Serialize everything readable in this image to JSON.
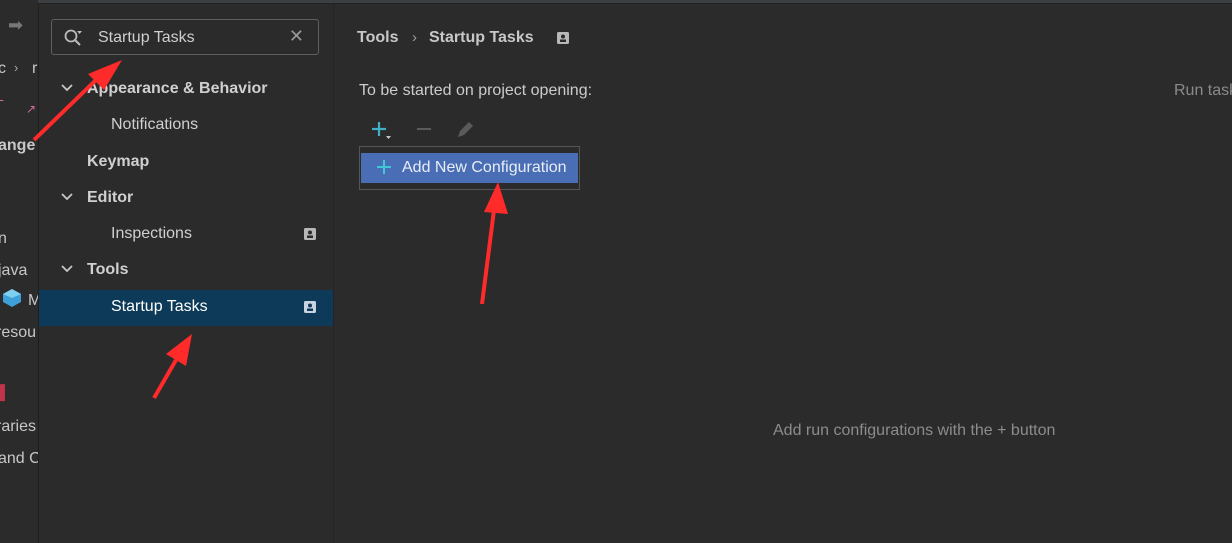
{
  "background_fragments": {
    "items": [
      "c",
      "r",
      "ange",
      "n",
      "java",
      "M",
      "resou",
      "raries",
      "and C"
    ]
  },
  "search": {
    "value": "Startup Tasks",
    "clear_icon": "close-icon"
  },
  "tree": {
    "items": [
      {
        "label": "Appearance & Behavior",
        "expanded": true
      },
      {
        "label": "Notifications"
      },
      {
        "label": "Keymap"
      },
      {
        "label": "Editor",
        "expanded": true
      },
      {
        "label": "Inspections"
      },
      {
        "label": "Tools",
        "expanded": true
      },
      {
        "label": "Startup Tasks",
        "selected": true
      }
    ]
  },
  "breadcrumb": {
    "parent": "Tools",
    "separator": "›",
    "current": "Startup Tasks"
  },
  "main": {
    "section_label": "To be started on project opening:",
    "run_label": "Run tasks",
    "add_item_label": "Add New Configuration",
    "empty_hint": "Add run configurations with the + button"
  },
  "colors": {
    "selection": "#0d3a58",
    "popup_selection": "#4a6eb5",
    "accent_plus": "#3fb0c8",
    "annotation": "#ff2a2a"
  }
}
